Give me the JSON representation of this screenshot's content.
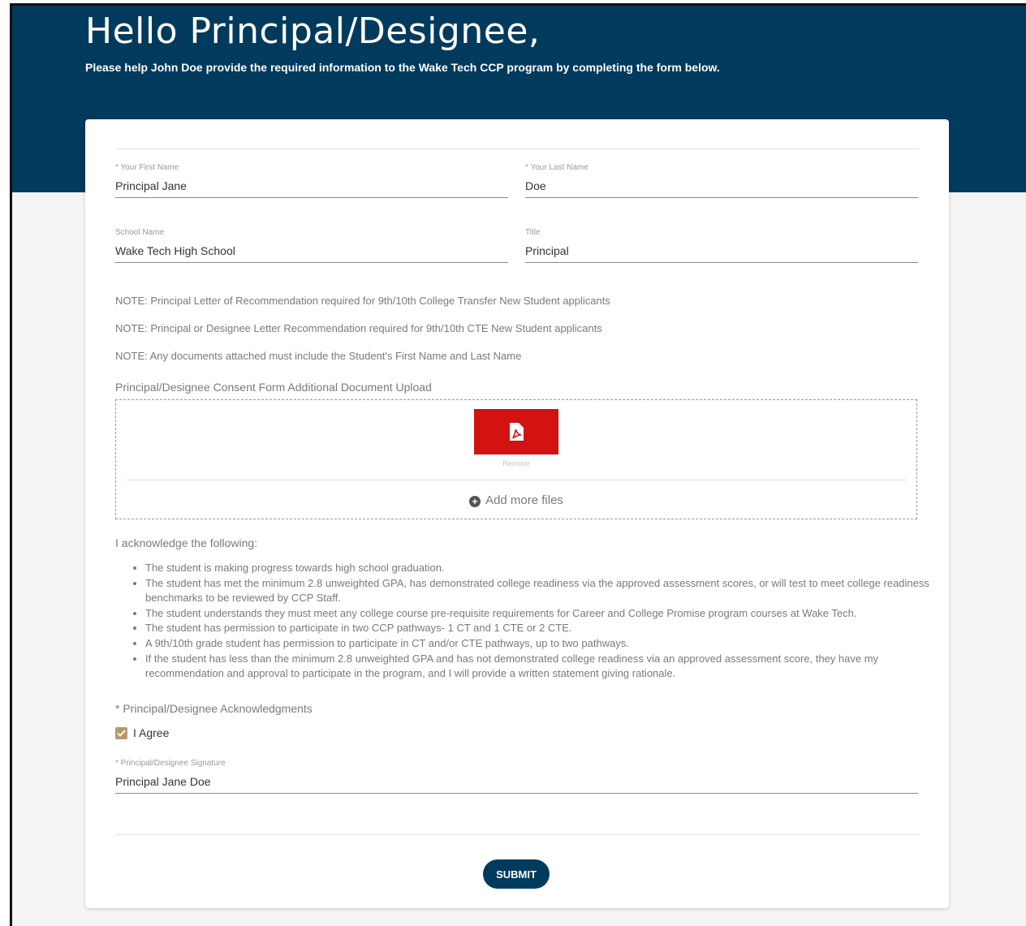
{
  "header": {
    "greeting": "Hello Principal/Designee,",
    "intro": "Please help John Doe provide the required information to the Wake Tech CCP program by completing the form below."
  },
  "form": {
    "first_name": {
      "label": "* Your First Name",
      "value": "Principal Jane"
    },
    "last_name": {
      "label": "* Your Last Name",
      "value": "Doe"
    },
    "school_name": {
      "label": "School Name",
      "value": "Wake Tech High School"
    },
    "title": {
      "label": "Title",
      "value": "Principal"
    },
    "notes": [
      "NOTE: Principal Letter of Recommendation required for 9th/10th College Transfer New Student applicants",
      "NOTE: Principal or Designee Letter Recommendation required for 9th/10th CTE New Student applicants",
      "NOTE: Any documents attached must include the Student's First Name and Last Name"
    ],
    "upload": {
      "label": "Principal/Designee Consent Form Additional Document Upload",
      "file_icon": "pdf-icon",
      "file_color": "#d31212",
      "remove_label": "Remove",
      "add_more_label": "Add more files"
    },
    "acknowledge": {
      "label": "I acknowledge the following:",
      "items": [
        "The student is making progress towards high school graduation.",
        "The student has met the minimum 2.8 unweighted GPA, has demonstrated college readiness via the approved assessment scores, or will test to meet college readiness benchmarks to be reviewed by CCP Staff.",
        "The student understands they must meet any college course pre-requisite requirements for Career and College Promise program courses at Wake Tech.",
        "The student has permission to participate in two CCP pathways- 1 CT and 1 CTE or 2 CTE.",
        "A 9th/10th grade student has permission to participate in CT and/or CTE pathways, up to two pathways.",
        "If the student has less than the minimum 2.8 unweighted GPA and has not demonstrated college readiness via an approved assessment score, they have my recommendation and approval to participate in the program, and I will provide a written statement giving rationale."
      ]
    },
    "acknowledgments_label": "* Principal/Designee Acknowledgments",
    "agree": {
      "label": "I Agree",
      "checked": true
    },
    "signature": {
      "label": "* Principal/Designee Signature",
      "value": "Principal Jane Doe"
    },
    "submit_label": "SUBMIT"
  },
  "colors": {
    "brand": "#003a5d",
    "checkbox": "#b59a6a",
    "pdf": "#d31212"
  }
}
